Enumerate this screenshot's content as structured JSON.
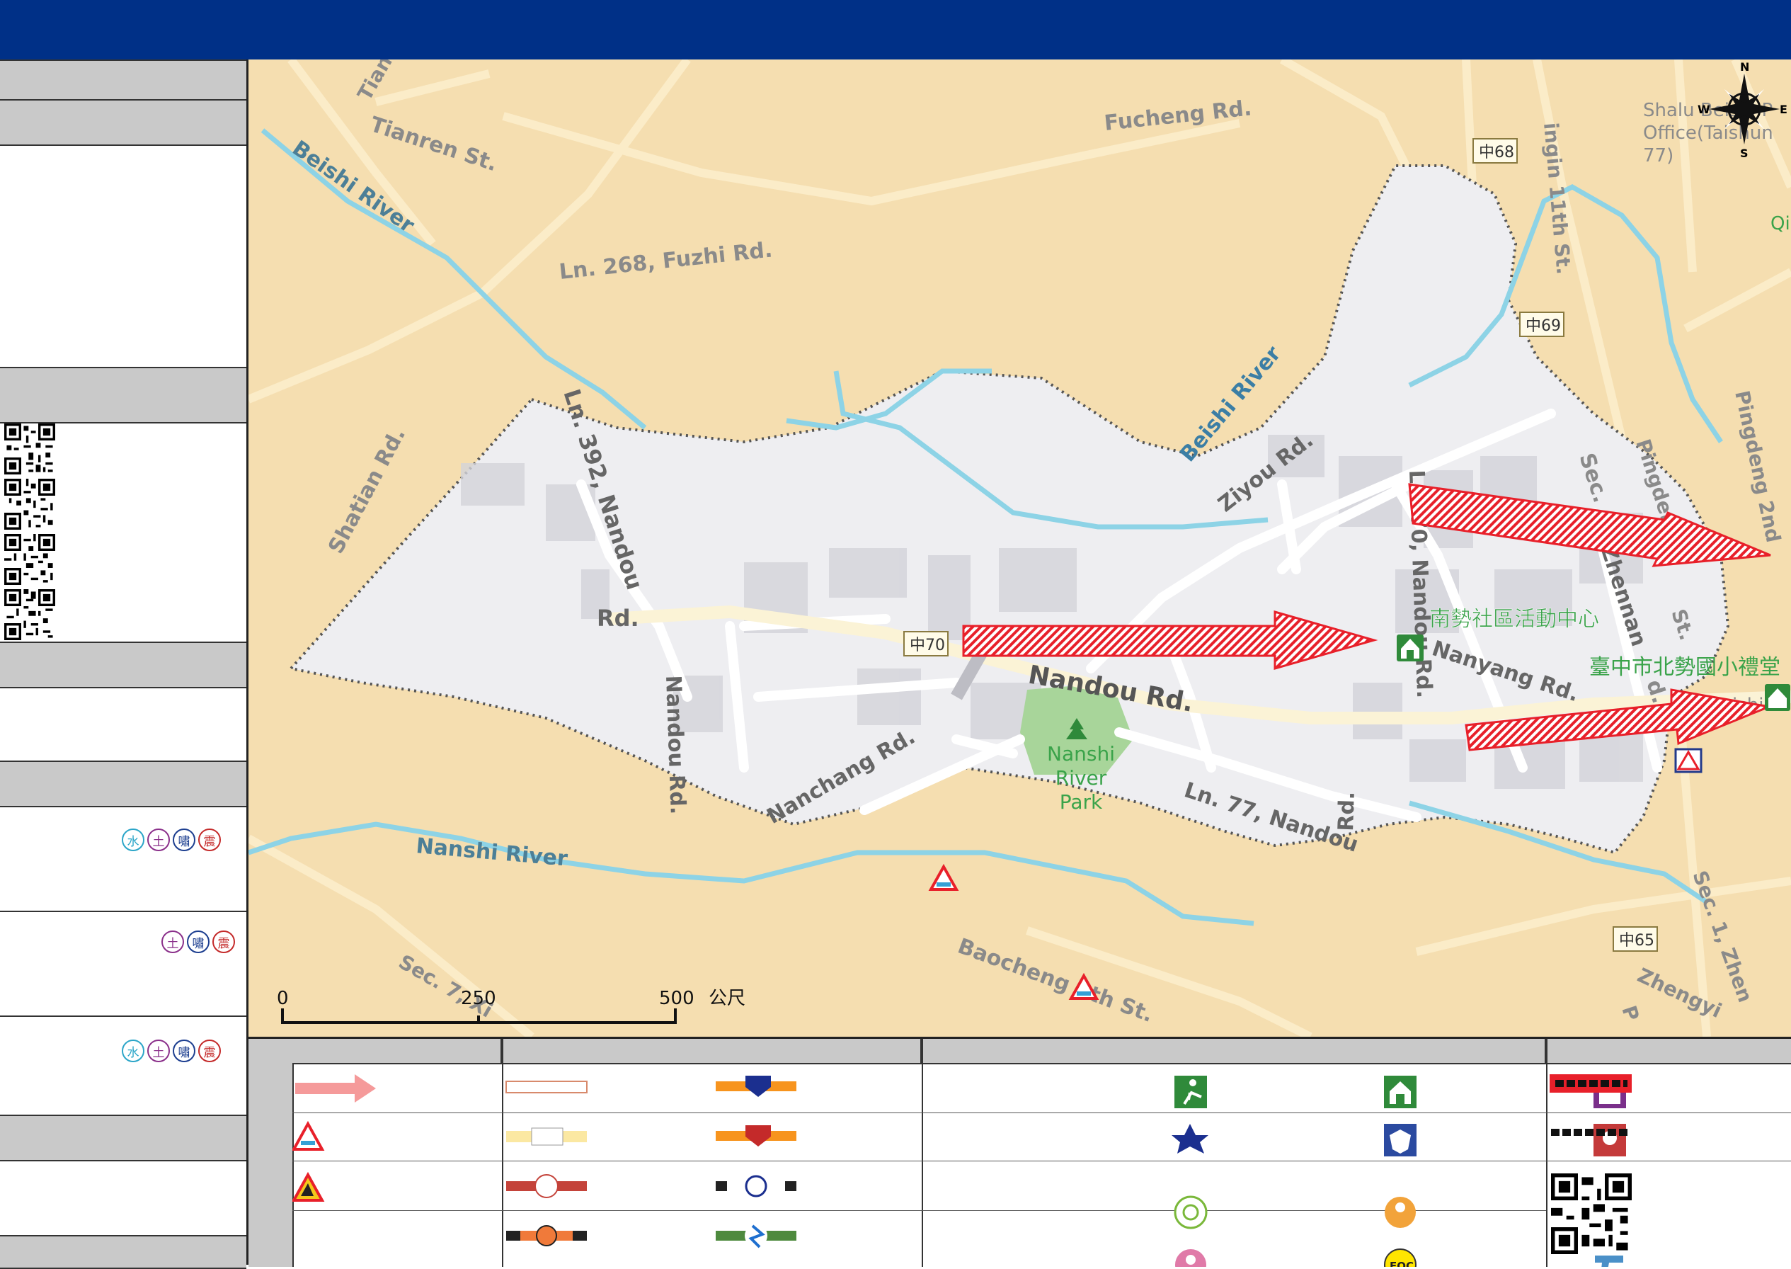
{
  "map": {
    "colors": {
      "outside": "#f5deb0",
      "area": "#eeeef1",
      "road": "#fffdf6",
      "water": "#8dd3e6",
      "park": "#a8d59a",
      "boundary": "#5a5a5a",
      "arrow": "#e8202a"
    },
    "roads": {
      "tianren": "Tianren St.",
      "tian": "Tian",
      "fucheng": "Fucheng Rd.",
      "fuzhi": "Ln. 268, Fuzhi Rd.",
      "shatian": "Shatian Rd.",
      "nandou_392": "Ln. 392, Nandou",
      "nandou_rd_a": "Rd.",
      "nandou_rd_b": "Nandou Rd.",
      "nandou_main": "Nandou Rd.",
      "ziyou": "Ziyou Rd.",
      "nanchang": "Nanchang Rd.",
      "nandou_77": "Ln. 77, Nandou",
      "rd_suffix": "Rd.",
      "ln70": "Ln. 70, Nandou Rd.",
      "nanyang": "Nanyang Rd.",
      "zhennan": "Sec. 1, Zhennan Rd.",
      "zhennan_short": "Zhennan",
      "pingdeng": "Pingdeng",
      "pingdeng2": "Pingdeng 2nd",
      "st": "St.",
      "baocheng": "Baocheng 5th St.",
      "sec7": "Sec. 7, Xi",
      "zhengyi": "Zhengyi",
      "sec1_zhen": "Sec. 1, Zhen",
      "ingin": "ingin 11th St.",
      "shalu": "Shalu Beishi P",
      "office": "Office(Taishun",
      "seventy7": "77)",
      "qi": "Qi",
      "beishi_e": "eishi E",
      "sec_short": "Sec.",
      "d_short": "d.",
      "p_short": "P"
    },
    "rivers": {
      "beishi_nw": "Beishi River",
      "beishi": "Beishi River",
      "nanshi": "Nanshi River"
    },
    "shields": [
      "中68",
      "中69",
      "中70",
      "中65"
    ],
    "park_label": "Nanshi\nRiver\nPark",
    "facilities": {
      "community_center": "南勢社區活動中心",
      "school_hall": "臺中市北勢國小禮堂"
    },
    "compass": {
      "n": "N",
      "s": "S",
      "e": "E",
      "w": "W"
    },
    "scale": {
      "t0": "0",
      "t250": "250",
      "t500": "500",
      "unit": "公尺"
    }
  },
  "sidebar": {
    "hazard_rows": [
      [
        "水",
        "土",
        "嘯",
        "震"
      ],
      [
        "土",
        "嘯",
        "震"
      ],
      [
        "水",
        "土",
        "嘯",
        "震"
      ]
    ]
  },
  "legend": {
    "eoc_label": "EOC"
  }
}
